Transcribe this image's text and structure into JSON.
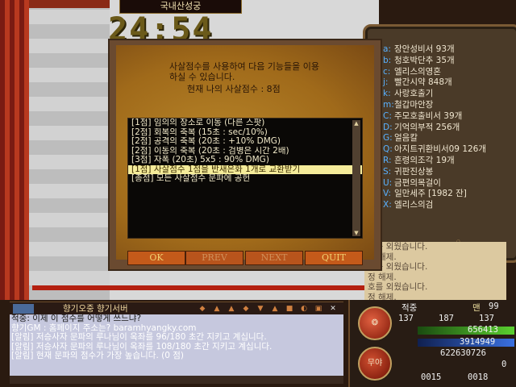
{
  "title": "국내산성궁",
  "timer": "24:54",
  "inventory": [
    {
      "key": "a:",
      "name": "장안성비서 93개"
    },
    {
      "key": "b:",
      "name": "청호박단추 35개"
    },
    {
      "key": "c:",
      "name": "엘리스의영혼"
    },
    {
      "key": "j:",
      "name": "빨간시약 848개"
    },
    {
      "key": "k:",
      "name": "사랑호출기"
    },
    {
      "key": "m:",
      "name": "철갑마안장"
    },
    {
      "key": "C:",
      "name": "주모호출비서 39개"
    },
    {
      "key": "D:",
      "name": "기억의부적 256개"
    },
    {
      "key": "G:",
      "name": "얼음칼"
    },
    {
      "key": "Q:",
      "name": "아지트귀환비서09 126개"
    },
    {
      "key": "R:",
      "name": "흔령의조각 19개"
    },
    {
      "key": "S:",
      "name": "귀판진상봉"
    },
    {
      "key": "U:",
      "name": "금편의목걸이"
    },
    {
      "key": "V:",
      "name": "일만세주 [1982 잔]"
    },
    {
      "key": "X:",
      "name": "엘리스의검"
    }
  ],
  "dialog": {
    "intro_line1": "사살점수를 사용하여 다음 기능들을 이용",
    "intro_line2": "하실 수 있습니다.",
    "score_line": "현재 나의 사살점수 : 8점",
    "options": [
      "[1점] 임의의 장소로 이동 (다른 스팟)",
      "[2점] 회복의 축복 (15초 : sec/10%)",
      "[2점] 공격의 축복 (20초 : +10% DMG)",
      "[2점] 이동의 축복 (20초 : 검병은 시간 2배)",
      "[3점] 자폭 (20초) 5x5 : 90% DMG)",
      "[1점] 사살점수 1점을 반새은화 1개로 교환받기",
      "[총점] 모든 사살점수 문파에 공헌"
    ],
    "selected_index": 5,
    "buttons": {
      "ok": "OK",
      "prev": "PREV",
      "next": "NEXT",
      "quit": "QUIT"
    }
  },
  "right_log": [
    "호를 외웠습니다.",
    "정 해제.",
    "호를 외웠습니다.",
    "정 해제.",
    "호를 외웠습니다.",
    "정 해제.",
    "호를 외웠습니다."
  ],
  "chat": {
    "title": "향기오중 향기서버",
    "lines": [
      {
        "text": "적중: 이제 이 점수를 어떻게 쓰느냐?",
        "style": "q"
      },
      {
        "text": "향기GM : 홈페이지 주소는? baramhyangky.com",
        "style": "w"
      },
      {
        "text": "[알림] 저승사자 문파의 루나님이 옥좌를 96/180 초간 지키고 계십니다.",
        "style": "w"
      },
      {
        "text": "[알림] 저승사자 문파의 루나님이 옥좌를 108/180 초간 지키고 계십니다.",
        "style": "w"
      },
      {
        "text": "[알림] 현재 문파의 점수가 가장 높습니다. (0 점)",
        "style": "w"
      }
    ]
  },
  "status": {
    "name": "적중",
    "level_label": "맨",
    "level": "99",
    "stat1": "137",
    "stat2": "187",
    "stat3": "137",
    "hp": "656413",
    "mp": "3914949",
    "exp": "622630726",
    "gold": "0",
    "coord_x": "0015",
    "coord_y": "0018",
    "orb_label": "무야"
  },
  "colors": {
    "accent": "#c45a1a",
    "selected": "#f5ec9a",
    "inv_key": "#58b0ff"
  }
}
